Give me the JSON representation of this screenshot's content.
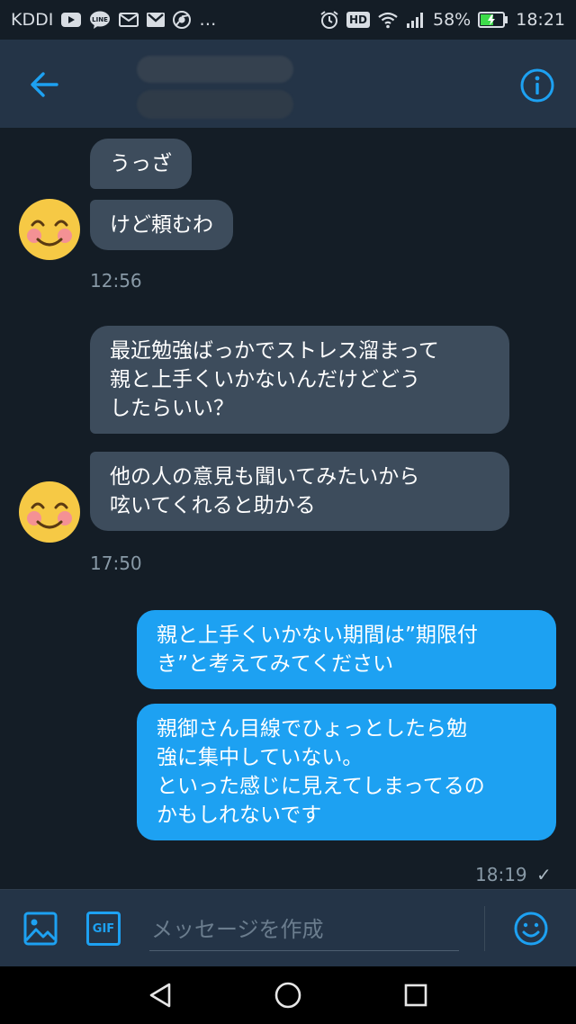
{
  "status_bar": {
    "carrier": "KDDI",
    "line_badge": "LINE",
    "more": "…",
    "hd_badge": "HD",
    "battery_percent": "58%",
    "time": "18:21",
    "battery_level": 0.58,
    "battery_color": "#3ddc4a"
  },
  "header": {
    "back_icon": "arrow-left-icon",
    "info_icon": "info-icon",
    "accent_color": "#1da1f2"
  },
  "messages": {
    "group1": {
      "msg1": "うっざ",
      "msg2": "けど頼むわ",
      "time": "12:56"
    },
    "group2": {
      "msg1": "最近勉強ばっかでストレス溜まって\n親と上手くいかないんだけどどう\nしたらいい？",
      "msg2": "他の人の意見も聞いてみたいから\n呟いてくれると助かる",
      "time": "17:50"
    },
    "group3": {
      "msg1": "親と上手くいかない期間は”期限付\nき”と考えてみてください",
      "msg2": "親御さん目線でひょっとしたら勉\n強に集中していない。\nといった感じに見えてしまってるの\nかもしれないです",
      "time": "18:19",
      "read_mark": "✓"
    }
  },
  "compose": {
    "placeholder": "メッセージを作成",
    "gif_label": "GIF",
    "image_icon": "image-icon",
    "emoji_icon": "emoji-icon"
  },
  "nav": {
    "back": "nav-back-icon",
    "home": "nav-home-icon",
    "recents": "nav-recents-icon"
  }
}
